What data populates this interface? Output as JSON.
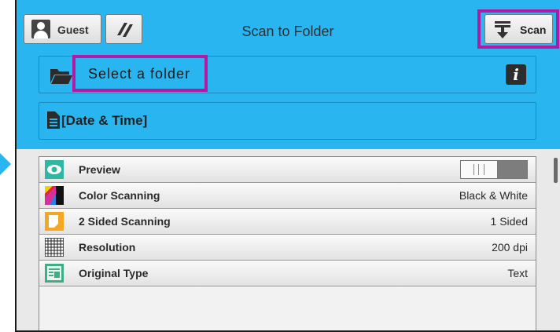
{
  "topbar": {
    "user_label": "Guest",
    "title": "Scan to Folder",
    "scan_label": "Scan"
  },
  "folder": {
    "label": "Select a folder",
    "info": "i"
  },
  "filename": {
    "label": "[Date & Time]"
  },
  "colors": {
    "accent": "#29b6f0",
    "highlight": "#b21aa3"
  },
  "settings": [
    {
      "label": "Preview",
      "icon": "eye-icon",
      "value": "",
      "toggle_on": false
    },
    {
      "label": "Color Scanning",
      "icon": "color-scanning-icon",
      "value": "Black & White"
    },
    {
      "label": "2 Sided Scanning",
      "icon": "two-sided-icon",
      "value": "1 Sided"
    },
    {
      "label": "Resolution",
      "icon": "grid-icon",
      "value": "200 dpi"
    },
    {
      "label": "Original Type",
      "icon": "original-type-icon",
      "value": "Text"
    }
  ]
}
